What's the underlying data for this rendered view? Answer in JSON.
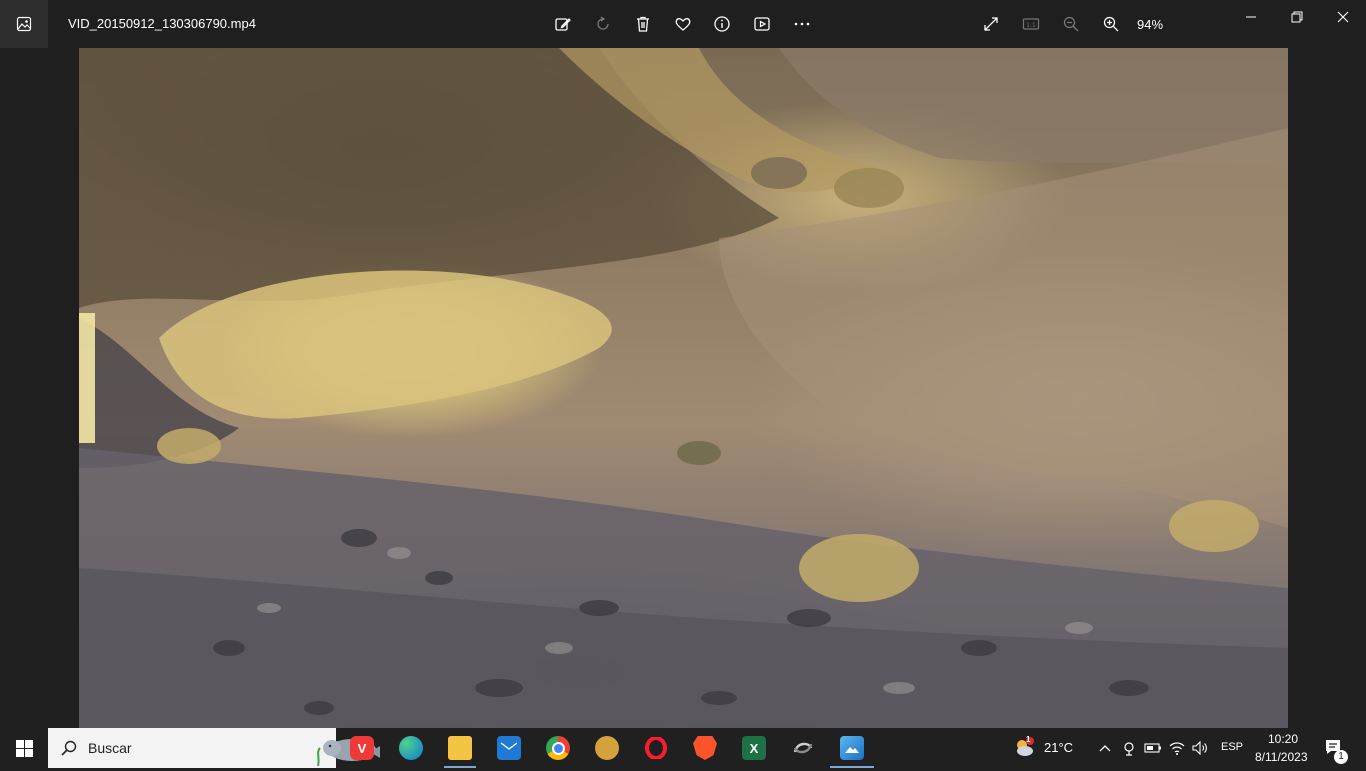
{
  "window": {
    "file_name": "VID_20150912_130306790.mp4",
    "zoom_level": "94%"
  },
  "toolbar": {
    "icons": [
      "edit-icon",
      "rotate-icon",
      "delete-icon",
      "favorite-icon",
      "info-icon",
      "slideshow-icon",
      "more-icon"
    ],
    "view_icons": [
      "fullscreen-icon",
      "actual-size-icon",
      "zoom-out-icon",
      "zoom-in-icon"
    ]
  },
  "taskbar": {
    "search_placeholder": "Buscar",
    "apps": [
      "vivaldi",
      "edge",
      "file-explorer",
      "mail",
      "chrome",
      "app-gold",
      "opera",
      "brave",
      "excel",
      "app-sync",
      "photos"
    ],
    "weather_temp": "21°C",
    "language": "ESP",
    "time": "10:20",
    "date": "8/11/2023",
    "notification_count": "1",
    "weather_badge": "1"
  },
  "colors": {
    "titlebar_bg": "#1f1f1f",
    "taskbar_bg": "#202020",
    "accent": "#7aa7d8"
  }
}
